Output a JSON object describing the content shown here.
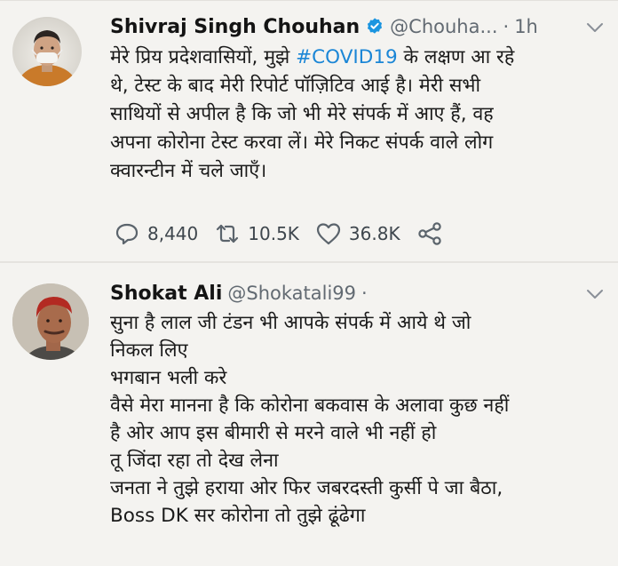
{
  "tweet1": {
    "name": "Shivraj Singh Chouhan",
    "handle": "@Chouha...",
    "separator": "·",
    "time": "1h",
    "lines": [
      {
        "pre": "मेरे प्रिय प्रदेशवासियों, मुझे ",
        "hashtag": "#COVID19",
        "post": " के लक्षण आ रहे"
      },
      "थे, टेस्ट के बाद मेरी रिपोर्ट पॉज़िटिव आई है। मेरी सभी",
      "साथियों से अपील है कि जो भी मेरे संपर्क में आए हैं, वह",
      "अपना कोरोना टेस्ट करवा लें। मेरे निकट संपर्क वाले लोग",
      "क्वारन्टीन में चले जाएँ।"
    ],
    "replies": "8,440",
    "retweets": "10.5K",
    "likes": "36.8K",
    "icons": {
      "verified": "verified-badge-icon",
      "chevron": "chevron-down-icon",
      "reply": "reply-icon",
      "retweet": "retweet-icon",
      "like": "heart-icon",
      "share": "share-icon"
    }
  },
  "tweet2": {
    "name": "Shokat Ali",
    "handle": "@Shokatali99",
    "separator": "·",
    "lines": [
      "सुना है लाल जी टंडन भी आपके संपर्क में आये थे जो",
      "निकल लिए",
      "भगबान भली करे",
      "वैसे मेरा मानना है कि कोरोना बकवास के अलावा कुछ नहीं",
      "है ओर आप इस बीमारी से मरने वाले भी नहीं हो",
      "तू जिंदा रहा तो देख लेना",
      "जनता ने तुझे हराया ओर फिर जबरदस्ती कुर्सी पे जा बैठा,",
      "Boss DK सर कोरोना तो तुझे ढूंढेगा"
    ]
  },
  "colors": {
    "background": "#f4f3f0",
    "hashtag": "#1b86d6",
    "verified": "#1b95e0",
    "secondary_text": "#626a72",
    "icon": "#5b646c"
  }
}
